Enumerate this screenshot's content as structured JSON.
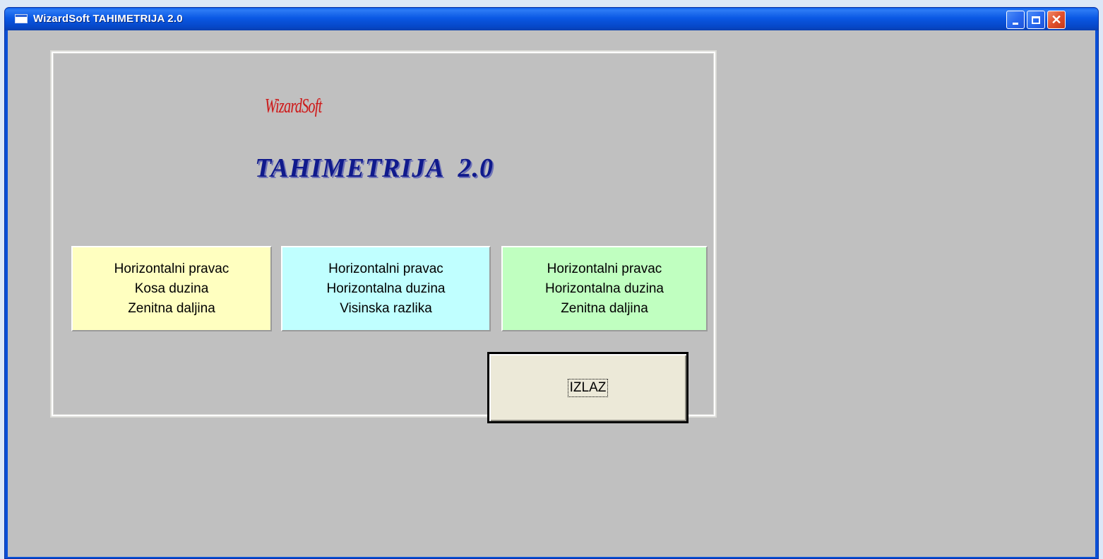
{
  "window": {
    "title": "WizardSoft TAHIMETRIJA 2.0",
    "icon": "app-window-icon",
    "controls": {
      "minimize_icon": "minimize-icon",
      "maximize_icon": "maximize-icon",
      "close_icon": "close-icon",
      "close_glyph": "✕"
    }
  },
  "branding": {
    "company": "WizardSoft",
    "product": "TAHIMETRIJA  2.0"
  },
  "options": [
    {
      "lines": [
        "Horizontalni pravac",
        "Kosa duzina",
        "Zenitna daljina"
      ],
      "color": "#ffffc0"
    },
    {
      "lines": [
        "Horizontalni pravac",
        "Horizontalna duzina",
        "Visinska razlika"
      ],
      "color": "#c0ffff"
    },
    {
      "lines": [
        "Horizontalni pravac",
        "Horizontalna duzina",
        "Zenitna daljina"
      ],
      "color": "#c0ffc0"
    }
  ],
  "exit_button": {
    "label": "IZLAZ"
  },
  "colors": {
    "titlebar": "#0a58e4",
    "client_background": "#c0c0c0",
    "brand_small": "#c81a1a",
    "brand_title": "#101a8c"
  }
}
